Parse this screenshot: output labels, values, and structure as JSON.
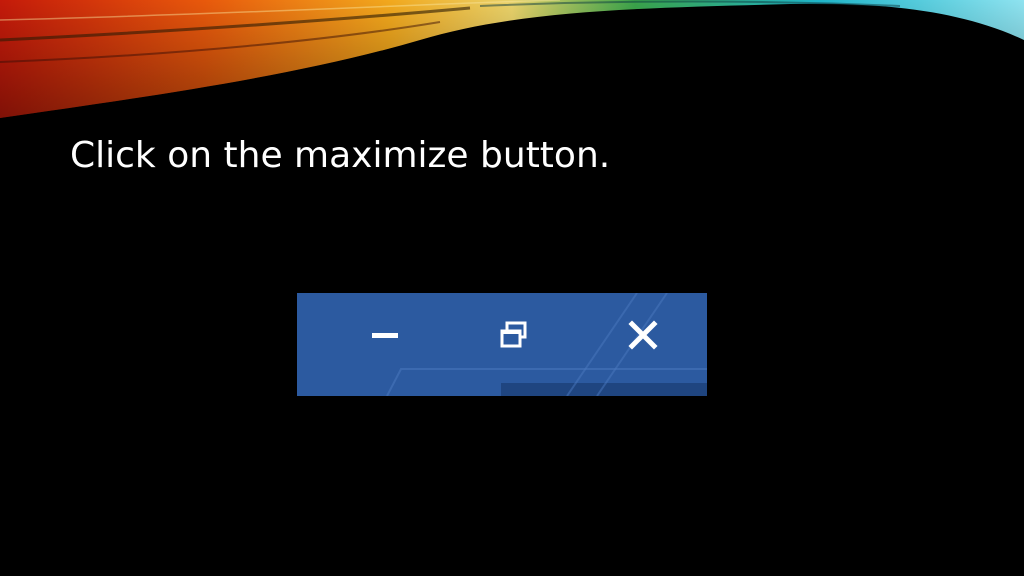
{
  "slide": {
    "instruction": "Click on the maximize button."
  },
  "window_controls": {
    "bar_color": "#2c5aa0",
    "accent_strip_color": "#1f4580",
    "icon_color": "#ffffff",
    "buttons": [
      {
        "name": "minimize",
        "icon": "minimize-icon"
      },
      {
        "name": "maximize",
        "icon": "restore-down-icon"
      },
      {
        "name": "close",
        "icon": "close-icon"
      }
    ]
  },
  "decoration": {
    "swoosh_colors": [
      "#c41a0a",
      "#e8590c",
      "#f2a81d",
      "#f7e07a",
      "#3aa34a",
      "#1fb5c9",
      "#8fe3f0"
    ]
  }
}
